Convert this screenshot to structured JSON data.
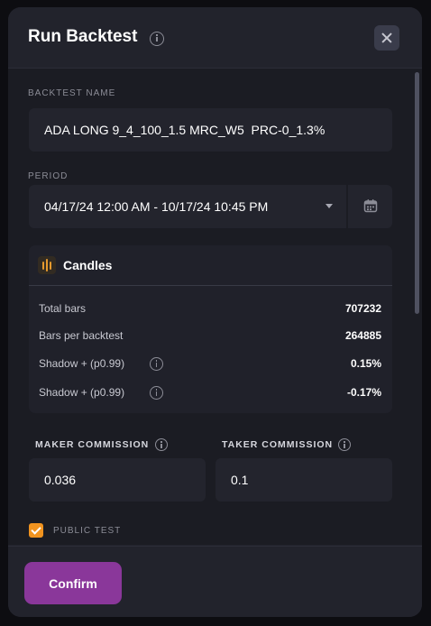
{
  "dialog": {
    "title": "Run Backtest",
    "close_icon": "close-icon",
    "info_icon": "info-icon"
  },
  "backtest_name": {
    "label": "BACKTEST NAME",
    "value": "ADA LONG 9_4_100_1.5 MRC_W5  PRC-0_1.3%"
  },
  "period": {
    "label": "PERIOD",
    "value": "04/17/24 12:00 AM - 10/17/24 10:45 PM",
    "calendar_icon": "calendar-icon"
  },
  "candles": {
    "title": "Candles",
    "icon": "candles-icon",
    "rows": [
      {
        "label": "Total bars",
        "value": "707232"
      },
      {
        "label": "Bars per backtest",
        "value": "264885"
      },
      {
        "label": "Shadow + (p0.99)",
        "value": "0.15%"
      },
      {
        "label": "Shadow + (p0.99)",
        "value": "-0.17%"
      }
    ]
  },
  "commission": {
    "maker_label": "MAKER COMMISSION",
    "maker_value": "0.036",
    "taker_label": "TAKER COMMISSION",
    "taker_value": "0.1"
  },
  "public_test": {
    "label": "PUBLIC TEST",
    "checked": true
  },
  "footer": {
    "confirm_label": "Confirm"
  },
  "colors": {
    "accent_purple": "#8a379a",
    "checkbox_orange": "#f0931f",
    "panel": "#22232c",
    "body": "#1b1c23"
  }
}
